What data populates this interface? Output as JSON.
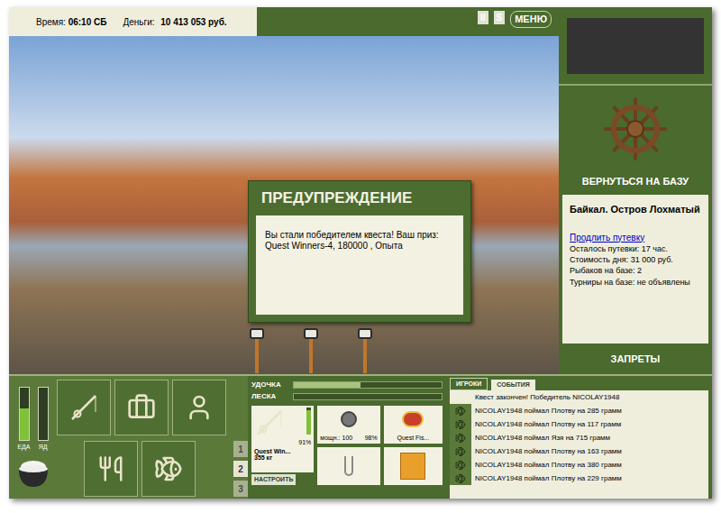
{
  "status": {
    "time_label": "Время:",
    "time": "06:10 СБ",
    "money_label": "Деньги:",
    "money": "10 413 053 руб."
  },
  "menu": [
    {
      "label": "II"
    },
    {
      "label": "S"
    },
    {
      "label": "МЕНЮ"
    }
  ],
  "dialog": {
    "title": "ПРЕДУПРЕЖДЕНИЕ",
    "message": "Вы стали победителем квеста! Ваш приз: Quest Winners-4, 180000 , Опыта"
  },
  "rod_stands": [
    {
      "occupied": true
    },
    {
      "occupied": true
    },
    {
      "occupied": true
    }
  ],
  "base": {
    "button": "ВЕРНУТЬСЯ НА БАЗУ",
    "location": "Байкал. Остров Лохматый",
    "extend_link": "Продлить путевку",
    "info": [
      "Осталось путевки: 17 час.",
      "Стоимость дня: 31 000 руб.",
      "Рыбаков на базе: 2",
      "Турниры на базе: не объявлены"
    ],
    "bans_button": "ЗАПРЕТЫ"
  },
  "meters": [
    {
      "label": "ЕДА",
      "level": 0.6
    },
    {
      "label": "ЯД",
      "level": 0
    }
  ],
  "action_buttons": [
    {
      "kind": "rod"
    },
    {
      "kind": "box"
    },
    {
      "kind": "fisherman"
    },
    {
      "kind": "food"
    },
    {
      "kind": "fish"
    }
  ],
  "pages": [
    {
      "label": "1",
      "selected": false
    },
    {
      "label": "2",
      "selected": true
    },
    {
      "label": "3",
      "selected": false
    }
  ],
  "tension": [
    {
      "label": "УДОЧКА",
      "level": 0.45
    },
    {
      "label": "ЛЕСКА",
      "level": 0
    }
  ],
  "tackle": {
    "rod": {
      "name": "Quest Win...",
      "load": "355 кг",
      "level": 0.91,
      "reading": "91%"
    },
    "reel": {
      "power": "мощн.: 100",
      "reading": "98%"
    },
    "bait": {
      "name": "Quest Fis..."
    },
    "setup_button": "НАСТРОИТЬ"
  },
  "feed_tabs": [
    {
      "label": "ИГРОКИ",
      "selected": true
    },
    {
      "label": "СОБЫТИЯ",
      "selected": false
    }
  ],
  "events": [
    {
      "text": "Квест закончен! Победитель NICOLAY1948",
      "icon": false
    },
    {
      "text": "NICOLAY1948 поймал Плотву на 285 грамм",
      "icon": true
    },
    {
      "text": "NICOLAY1948 поймал Плотву на 117 грамм",
      "icon": true
    },
    {
      "text": "NICOLAY1948 поймал Язя на 715 грамм",
      "icon": true
    },
    {
      "text": "NICOLAY1948 поймал Плотву на 163 грамм",
      "icon": true
    },
    {
      "text": "NICOLAY1948 поймал Плотву на 380 грамм",
      "icon": true
    },
    {
      "text": "NICOLAY1948 поймал Плотву на 229 грамм",
      "icon": true
    }
  ]
}
